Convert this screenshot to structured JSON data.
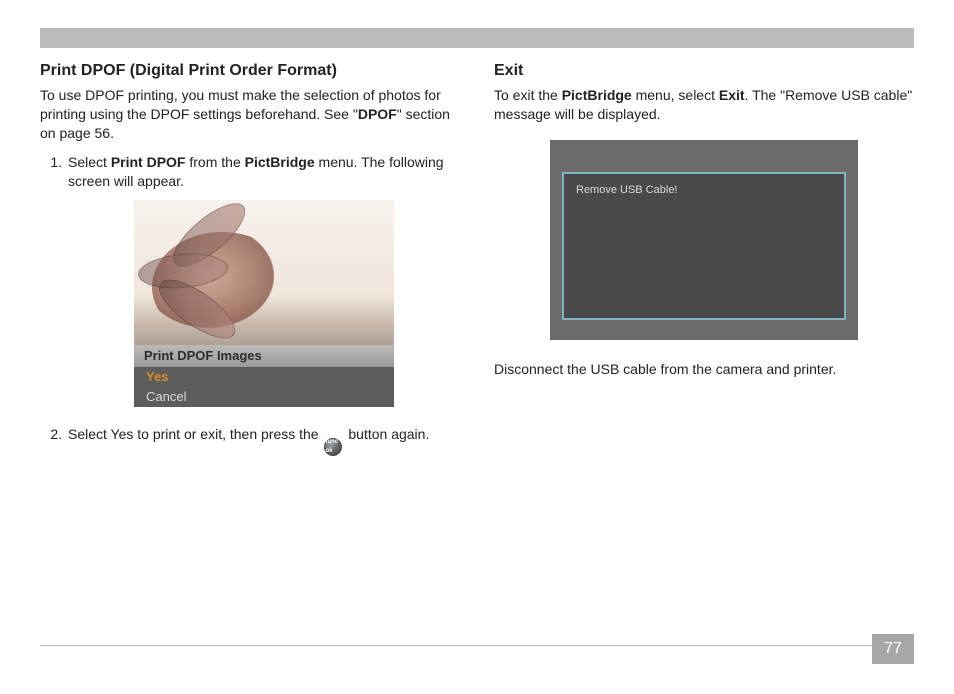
{
  "page_number": "77",
  "left": {
    "heading": "Print DPOF (Digital Print Order Format)",
    "intro_parts": {
      "p1": "To use DPOF printing, you must make the selection of photos for printing using the DPOF settings beforehand. See \"",
      "bold": "DPOF",
      "p2": "\" section on page 56."
    },
    "steps": {
      "s1_a": "Select ",
      "s1_b": "Print DPOF",
      "s1_c": " from the ",
      "s1_d": "PictBridge",
      "s1_e": " menu.  The following screen will appear.",
      "s2_a": "Select Yes to print or exit, then press the ",
      "s2_button": "func ok",
      "s2_b": " button again."
    },
    "camera_menu": {
      "title": "Print DPOF Images",
      "option_selected": "Yes",
      "option_other": "Cancel"
    }
  },
  "right": {
    "heading": "Exit",
    "intro_parts": {
      "p1": "To exit the ",
      "b1": "PictBridge",
      "p2": " menu, select ",
      "b2": "Exit",
      "p3": ". The \"Remove USB cable\" message will be displayed."
    },
    "usb_message": "Remove USB Cable!",
    "outro": "Disconnect the USB cable from the camera and printer."
  }
}
